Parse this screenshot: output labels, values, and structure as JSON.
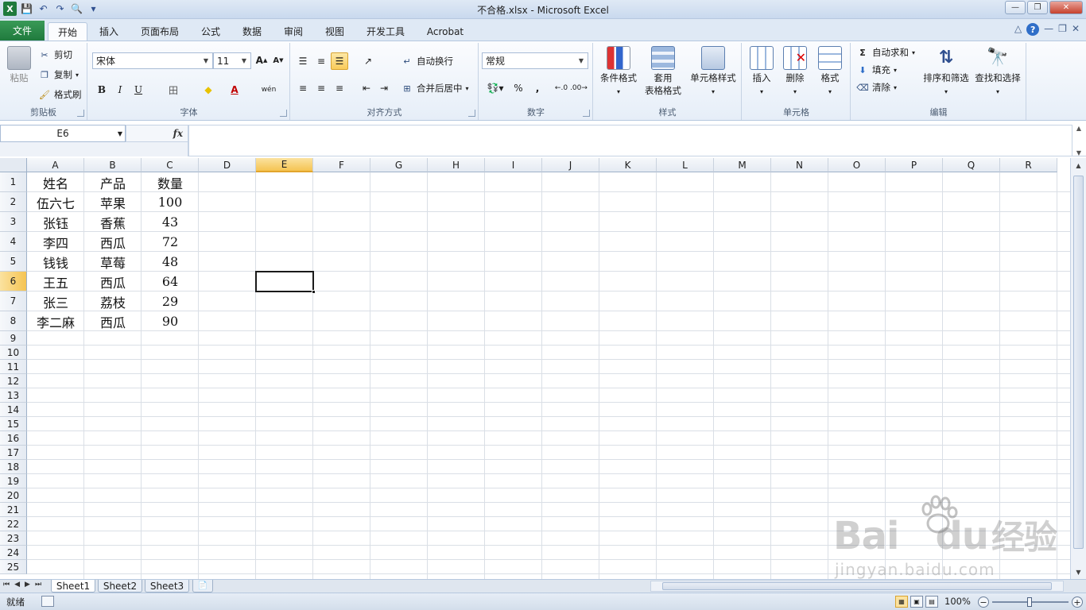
{
  "window": {
    "title": "不合格.xlsx  -  Microsoft Excel",
    "controls": {
      "minimize": "—",
      "restore": "❐",
      "close": "✕"
    }
  },
  "qat": {
    "excel_logo": "X",
    "save": "💾",
    "undo": "↶",
    "redo": "↷",
    "print_preview": "🔍",
    "customize": "▾"
  },
  "tabs": [
    {
      "label": "文件"
    },
    {
      "label": "开始"
    },
    {
      "label": "插入"
    },
    {
      "label": "页面布局"
    },
    {
      "label": "公式"
    },
    {
      "label": "数据"
    },
    {
      "label": "审阅"
    },
    {
      "label": "视图"
    },
    {
      "label": "开发工具"
    },
    {
      "label": "Acrobat"
    }
  ],
  "active_tab_label": "开始",
  "ribbon": {
    "clipboard": {
      "label": "剪贴板",
      "paste": "粘贴",
      "cut": "剪切",
      "copy": "复制",
      "format_painter": "格式刷"
    },
    "font": {
      "label": "字体",
      "name": "宋体",
      "size": "11",
      "grow": "A",
      "shrink": "A",
      "bold": "B",
      "italic": "I",
      "underline": "U",
      "border": "田",
      "fill": "◆",
      "color": "A",
      "wen": "wén"
    },
    "alignment": {
      "label": "对齐方式",
      "wrap": "自动换行",
      "merge": "合并后居中"
    },
    "number": {
      "label": "数字",
      "format": "常规",
      "percent": "%",
      "comma": ","
    },
    "styles": {
      "label": "样式",
      "conditional": "条件格式",
      "table_line1": "套用",
      "table_line2": "表格格式",
      "cell_styles": "单元格样式"
    },
    "cells": {
      "label": "单元格",
      "insert": "插入",
      "delete": "删除",
      "format": "格式"
    },
    "editing": {
      "label": "编辑",
      "autosum": "自动求和",
      "fill": "填充",
      "clear": "清除",
      "sort": "排序和筛选",
      "find": "查找和选择"
    }
  },
  "formula_bar": {
    "name_box": "E6",
    "fx": "fx",
    "value": ""
  },
  "columns": [
    "A",
    "B",
    "C",
    "D",
    "E",
    "F",
    "G",
    "H",
    "I",
    "J",
    "K",
    "L",
    "M",
    "N",
    "O",
    "P",
    "Q",
    "R"
  ],
  "selected_column": "E",
  "rows": [
    "1",
    "2",
    "3",
    "4",
    "5",
    "6",
    "7",
    "8",
    "9",
    "10",
    "11",
    "12",
    "13",
    "14",
    "15",
    "16",
    "17",
    "18",
    "19",
    "20",
    "21",
    "22",
    "23",
    "24",
    "25"
  ],
  "selected_row": "6",
  "data": [
    [
      "姓名",
      "产品",
      "数量"
    ],
    [
      "伍六七",
      "苹果",
      "100"
    ],
    [
      "张钰",
      "香蕉",
      "43"
    ],
    [
      "李四",
      "西瓜",
      "72"
    ],
    [
      "钱钱",
      "草莓",
      "48"
    ],
    [
      "王五",
      "西瓜",
      "64"
    ],
    [
      "张三",
      "荔枝",
      "29"
    ],
    [
      "李二麻",
      "西瓜",
      "90"
    ]
  ],
  "sheets": [
    "Sheet1",
    "Sheet2",
    "Sheet3"
  ],
  "active_sheet": "Sheet1",
  "status": {
    "ready": "就绪",
    "zoom": "100%"
  },
  "watermark": {
    "brand": "Bai",
    "brand_du": "du",
    "brand_cn": "经验",
    "url": "jingyan.baidu.com"
  }
}
